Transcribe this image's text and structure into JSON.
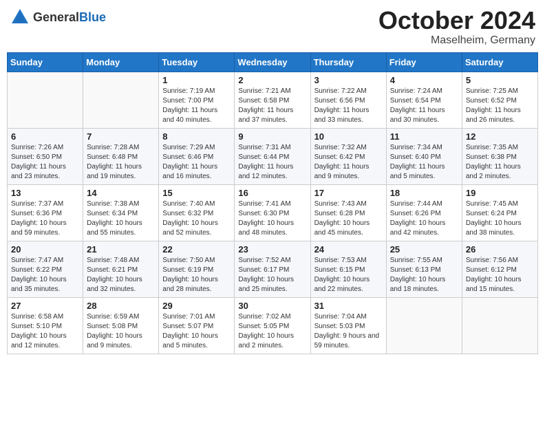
{
  "header": {
    "logo_general": "General",
    "logo_blue": "Blue",
    "month_title": "October 2024",
    "location": "Maselheim, Germany"
  },
  "weekdays": [
    "Sunday",
    "Monday",
    "Tuesday",
    "Wednesday",
    "Thursday",
    "Friday",
    "Saturday"
  ],
  "weeks": [
    [
      {
        "day": "",
        "info": ""
      },
      {
        "day": "",
        "info": ""
      },
      {
        "day": "1",
        "info": "Sunrise: 7:19 AM\nSunset: 7:00 PM\nDaylight: 11 hours and 40 minutes."
      },
      {
        "day": "2",
        "info": "Sunrise: 7:21 AM\nSunset: 6:58 PM\nDaylight: 11 hours and 37 minutes."
      },
      {
        "day": "3",
        "info": "Sunrise: 7:22 AM\nSunset: 6:56 PM\nDaylight: 11 hours and 33 minutes."
      },
      {
        "day": "4",
        "info": "Sunrise: 7:24 AM\nSunset: 6:54 PM\nDaylight: 11 hours and 30 minutes."
      },
      {
        "day": "5",
        "info": "Sunrise: 7:25 AM\nSunset: 6:52 PM\nDaylight: 11 hours and 26 minutes."
      }
    ],
    [
      {
        "day": "6",
        "info": "Sunrise: 7:26 AM\nSunset: 6:50 PM\nDaylight: 11 hours and 23 minutes."
      },
      {
        "day": "7",
        "info": "Sunrise: 7:28 AM\nSunset: 6:48 PM\nDaylight: 11 hours and 19 minutes."
      },
      {
        "day": "8",
        "info": "Sunrise: 7:29 AM\nSunset: 6:46 PM\nDaylight: 11 hours and 16 minutes."
      },
      {
        "day": "9",
        "info": "Sunrise: 7:31 AM\nSunset: 6:44 PM\nDaylight: 11 hours and 12 minutes."
      },
      {
        "day": "10",
        "info": "Sunrise: 7:32 AM\nSunset: 6:42 PM\nDaylight: 11 hours and 9 minutes."
      },
      {
        "day": "11",
        "info": "Sunrise: 7:34 AM\nSunset: 6:40 PM\nDaylight: 11 hours and 5 minutes."
      },
      {
        "day": "12",
        "info": "Sunrise: 7:35 AM\nSunset: 6:38 PM\nDaylight: 11 hours and 2 minutes."
      }
    ],
    [
      {
        "day": "13",
        "info": "Sunrise: 7:37 AM\nSunset: 6:36 PM\nDaylight: 10 hours and 59 minutes."
      },
      {
        "day": "14",
        "info": "Sunrise: 7:38 AM\nSunset: 6:34 PM\nDaylight: 10 hours and 55 minutes."
      },
      {
        "day": "15",
        "info": "Sunrise: 7:40 AM\nSunset: 6:32 PM\nDaylight: 10 hours and 52 minutes."
      },
      {
        "day": "16",
        "info": "Sunrise: 7:41 AM\nSunset: 6:30 PM\nDaylight: 10 hours and 48 minutes."
      },
      {
        "day": "17",
        "info": "Sunrise: 7:43 AM\nSunset: 6:28 PM\nDaylight: 10 hours and 45 minutes."
      },
      {
        "day": "18",
        "info": "Sunrise: 7:44 AM\nSunset: 6:26 PM\nDaylight: 10 hours and 42 minutes."
      },
      {
        "day": "19",
        "info": "Sunrise: 7:45 AM\nSunset: 6:24 PM\nDaylight: 10 hours and 38 minutes."
      }
    ],
    [
      {
        "day": "20",
        "info": "Sunrise: 7:47 AM\nSunset: 6:22 PM\nDaylight: 10 hours and 35 minutes."
      },
      {
        "day": "21",
        "info": "Sunrise: 7:48 AM\nSunset: 6:21 PM\nDaylight: 10 hours and 32 minutes."
      },
      {
        "day": "22",
        "info": "Sunrise: 7:50 AM\nSunset: 6:19 PM\nDaylight: 10 hours and 28 minutes."
      },
      {
        "day": "23",
        "info": "Sunrise: 7:52 AM\nSunset: 6:17 PM\nDaylight: 10 hours and 25 minutes."
      },
      {
        "day": "24",
        "info": "Sunrise: 7:53 AM\nSunset: 6:15 PM\nDaylight: 10 hours and 22 minutes."
      },
      {
        "day": "25",
        "info": "Sunrise: 7:55 AM\nSunset: 6:13 PM\nDaylight: 10 hours and 18 minutes."
      },
      {
        "day": "26",
        "info": "Sunrise: 7:56 AM\nSunset: 6:12 PM\nDaylight: 10 hours and 15 minutes."
      }
    ],
    [
      {
        "day": "27",
        "info": "Sunrise: 6:58 AM\nSunset: 5:10 PM\nDaylight: 10 hours and 12 minutes."
      },
      {
        "day": "28",
        "info": "Sunrise: 6:59 AM\nSunset: 5:08 PM\nDaylight: 10 hours and 9 minutes."
      },
      {
        "day": "29",
        "info": "Sunrise: 7:01 AM\nSunset: 5:07 PM\nDaylight: 10 hours and 5 minutes."
      },
      {
        "day": "30",
        "info": "Sunrise: 7:02 AM\nSunset: 5:05 PM\nDaylight: 10 hours and 2 minutes."
      },
      {
        "day": "31",
        "info": "Sunrise: 7:04 AM\nSunset: 5:03 PM\nDaylight: 9 hours and 59 minutes."
      },
      {
        "day": "",
        "info": ""
      },
      {
        "day": "",
        "info": ""
      }
    ]
  ]
}
